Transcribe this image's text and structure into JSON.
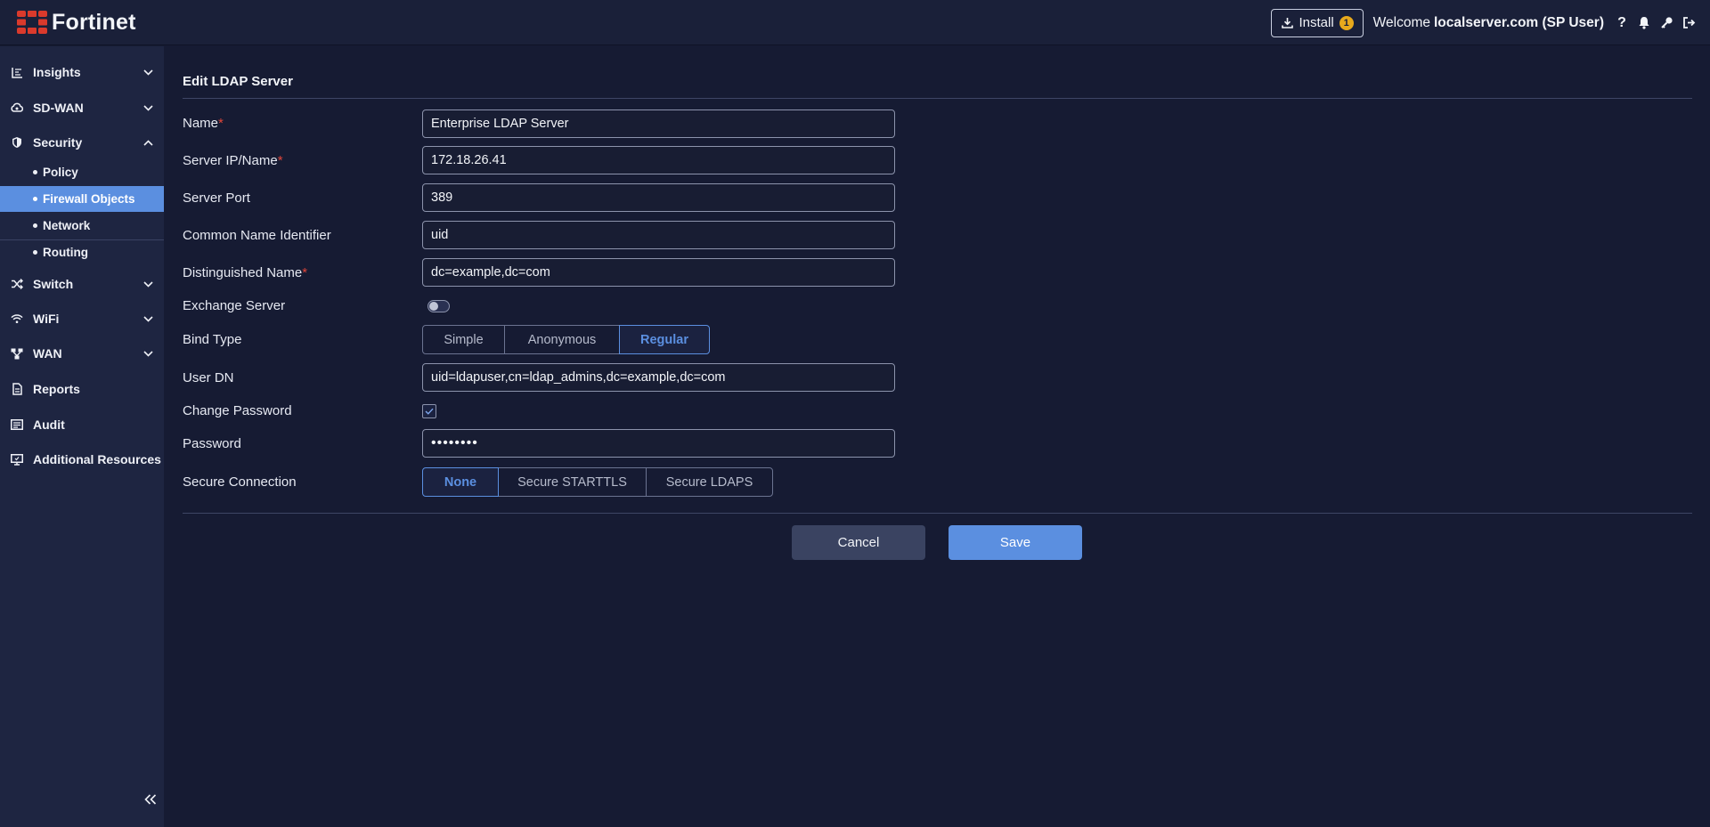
{
  "app": {
    "brand": "Fortinet",
    "brand_color": "#da3a2c",
    "accent_color": "#5b8fe0"
  },
  "header": {
    "install_label": "Install",
    "install_badge": "1",
    "welcome_prefix": "Welcome",
    "welcome_user": "localserver.com (SP User)",
    "help_glyph": "?",
    "icons": [
      "help-icon",
      "bell-icon",
      "key-icon",
      "logout-icon"
    ]
  },
  "sidebar": {
    "items": [
      {
        "label": "Insights",
        "icon": "chart-icon",
        "expanded": false
      },
      {
        "label": "SD-WAN",
        "icon": "cloud-icon",
        "expanded": false
      },
      {
        "label": "Security",
        "icon": "shield-icon",
        "expanded": true
      },
      {
        "label": "Switch",
        "icon": "shuffle-icon",
        "expanded": false
      },
      {
        "label": "WiFi",
        "icon": "wifi-icon",
        "expanded": false
      },
      {
        "label": "WAN",
        "icon": "network-icon",
        "expanded": false
      },
      {
        "label": "Reports",
        "icon": "document-icon"
      },
      {
        "label": "Audit",
        "icon": "list-icon"
      },
      {
        "label": "Additional Resources",
        "icon": "monitor-icon"
      }
    ],
    "security_children": [
      {
        "label": "Policy",
        "active": false
      },
      {
        "label": "Firewall Objects",
        "active": true
      },
      {
        "label": "Network",
        "active": false
      },
      {
        "label": "Routing",
        "active": false
      }
    ]
  },
  "form": {
    "title": "Edit LDAP Server",
    "name": {
      "label": "Name",
      "value": "Enterprise LDAP Server",
      "required": true
    },
    "server": {
      "label": "Server IP/Name",
      "value": "172.18.26.41",
      "required": true
    },
    "port": {
      "label": "Server Port",
      "value": "389"
    },
    "cn_identifier": {
      "label": "Common Name Identifier",
      "value": "uid"
    },
    "dn": {
      "label": "Distinguished Name",
      "value": "dc=example,dc=com",
      "required": true
    },
    "exchange": {
      "label": "Exchange Server",
      "enabled": false
    },
    "bind_type": {
      "label": "Bind Type",
      "options": [
        "Simple",
        "Anonymous",
        "Regular"
      ],
      "selected": "Regular"
    },
    "user_dn": {
      "label": "User DN",
      "value": "uid=ldapuser,cn=ldap_admins,dc=example,dc=com"
    },
    "change_password": {
      "label": "Change Password",
      "checked": true
    },
    "password": {
      "label": "Password",
      "value": "12345678"
    },
    "secure": {
      "label": "Secure Connection",
      "options": [
        "None",
        "Secure STARTTLS",
        "Secure LDAPS"
      ],
      "selected": "None"
    },
    "required_marker": "*",
    "cancel_label": "Cancel",
    "save_label": "Save"
  }
}
